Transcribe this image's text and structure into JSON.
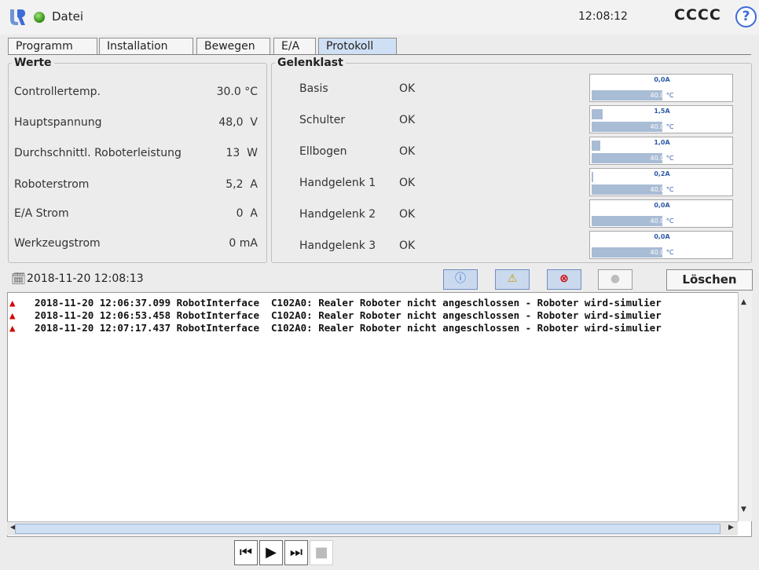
{
  "header": {
    "file_label": "Datei",
    "clock": "12:08:12",
    "robot_name": "CCCC",
    "help_label": "?"
  },
  "tabs": [
    {
      "label": "Programm",
      "active": false
    },
    {
      "label": "Installation",
      "active": false
    },
    {
      "label": "Bewegen",
      "active": false
    },
    {
      "label": "E/A",
      "active": false
    },
    {
      "label": "Protokoll",
      "active": true
    }
  ],
  "values_panel": {
    "title": "Werte",
    "rows": [
      {
        "label": "Controllertemp.",
        "value": "30.0 °C"
      },
      {
        "label": "Hauptspannung",
        "value": "48,0  V"
      },
      {
        "label": "Durchschnittl. Roboterleistung",
        "value": "13  W"
      },
      {
        "label": "Roboterstrom",
        "value": "5,2  A"
      },
      {
        "label": "E/A Strom",
        "value": "0  A"
      },
      {
        "label": "Werkzeugstrom",
        "value": "0 mA"
      }
    ]
  },
  "joint_panel": {
    "title": "Gelenklast",
    "rows": [
      {
        "label": "Basis",
        "status": "OK",
        "current": "0,0A",
        "current_fill": 0.0,
        "temp_num": "40.0",
        "temp_unit": "°C"
      },
      {
        "label": "Schulter",
        "status": "OK",
        "current": "1,5A",
        "current_fill": 0.08,
        "temp_num": "40.0",
        "temp_unit": "°C"
      },
      {
        "label": "Ellbogen",
        "status": "OK",
        "current": "1,0A",
        "current_fill": 0.06,
        "temp_num": "40.0",
        "temp_unit": "°C"
      },
      {
        "label": "Handgelenk 1",
        "status": "OK",
        "current": "0,2A",
        "current_fill": 0.01,
        "temp_num": "40.0",
        "temp_unit": "°C"
      },
      {
        "label": "Handgelenk 2",
        "status": "OK",
        "current": "0,0A",
        "current_fill": 0.0,
        "temp_num": "40.0",
        "temp_unit": "°C"
      },
      {
        "label": "Handgelenk 3",
        "status": "OK",
        "current": "0,0A",
        "current_fill": 0.0,
        "temp_num": "40.0",
        "temp_unit": "°C"
      }
    ]
  },
  "log": {
    "date": "2018-11-20 12:08:13",
    "clear_label": "Löschen",
    "filters": [
      {
        "name": "info",
        "icon": "info-icon",
        "glyph": "ⓘ",
        "on": true
      },
      {
        "name": "warning",
        "icon": "warning-icon",
        "glyph": "⚠",
        "on": true
      },
      {
        "name": "error",
        "icon": "error-icon",
        "glyph": "⊗",
        "on": true
      },
      {
        "name": "debug",
        "icon": "debug-icon",
        "glyph": "●",
        "on": false
      }
    ],
    "entries": [
      {
        "icon": "warning-icon",
        "text": "2018-11-20 12:06:37.099 RobotInterface  C102A0: Realer Roboter nicht angeschlossen - Roboter wird-simulier"
      },
      {
        "icon": "warning-icon",
        "text": "2018-11-20 12:06:53.458 RobotInterface  C102A0: Realer Roboter nicht angeschlossen - Roboter wird-simulier"
      },
      {
        "icon": "warning-icon",
        "text": "2018-11-20 12:07:17.437 RobotInterface  C102A0: Realer Roboter nicht angeschlossen - Roboter wird-simulier"
      }
    ]
  },
  "playback": {
    "buttons": [
      "skip-to-start-icon",
      "play-icon",
      "step-forward-icon",
      "stop-icon"
    ]
  },
  "colors": {
    "accent": "#3d6bd8",
    "active_tab": "#cfe0f4",
    "gauge_fill": "#a9bcd5",
    "warning_red": "#d40000",
    "status_green": "#2f8a12"
  }
}
